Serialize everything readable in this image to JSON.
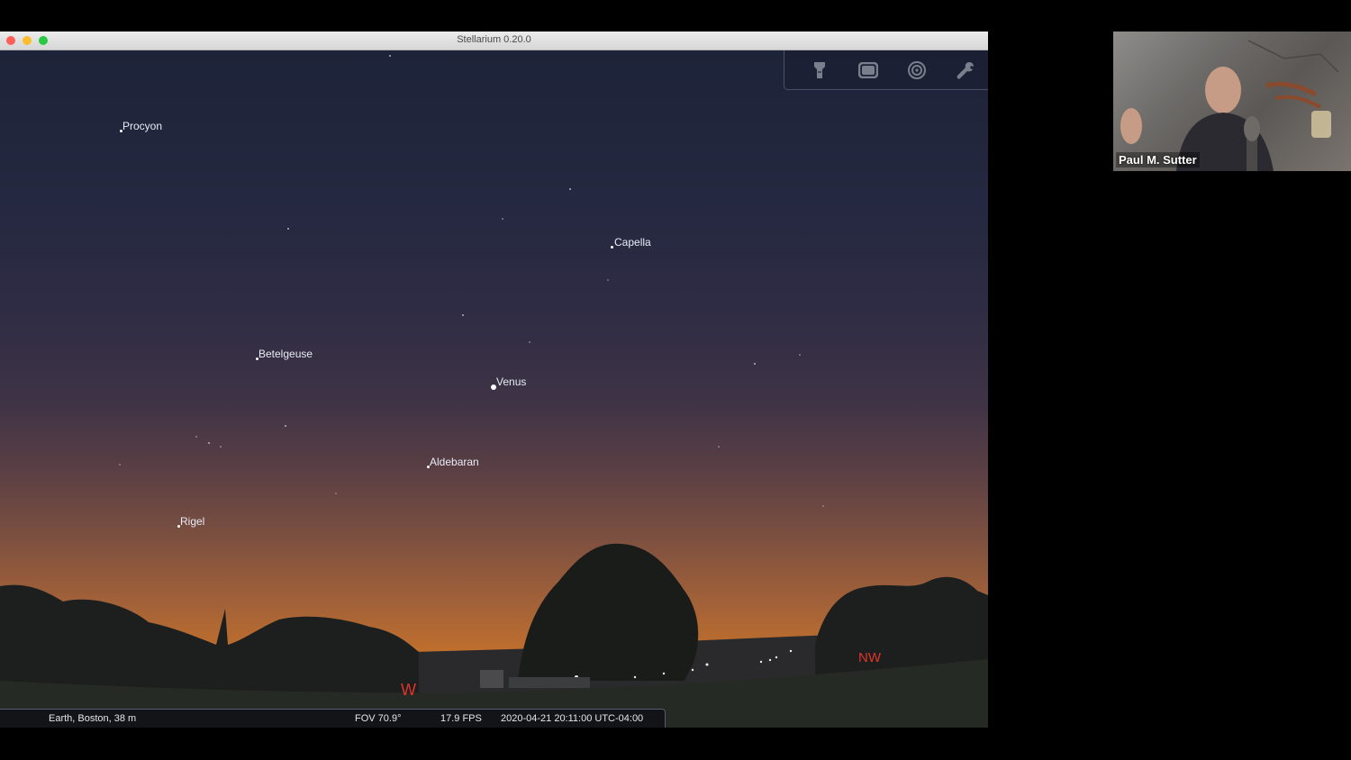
{
  "window": {
    "title": "Stellarium 0.20.0"
  },
  "toolbar": {
    "icons": [
      "flashlight-icon",
      "fullscreen-icon",
      "target-icon",
      "wrench-icon"
    ]
  },
  "sky": {
    "stars": [
      {
        "name": "Procyon"
      },
      {
        "name": "Capella"
      },
      {
        "name": "Betelgeuse"
      },
      {
        "name": "Venus"
      },
      {
        "name": "Aldebaran"
      },
      {
        "name": "Rigel"
      }
    ],
    "compass": {
      "west": "W",
      "northwest": "NW"
    }
  },
  "status": {
    "location": "Earth, Boston, 38 m",
    "fov": "FOV 70.9°",
    "fps": "17.9 FPS",
    "datetime": "2020-04-21 20:11:00 UTC-04:00"
  },
  "webcam": {
    "name": "Paul M. Sutter"
  },
  "colors": {
    "compass": "#e0342a",
    "label": "#e8ecf5"
  }
}
